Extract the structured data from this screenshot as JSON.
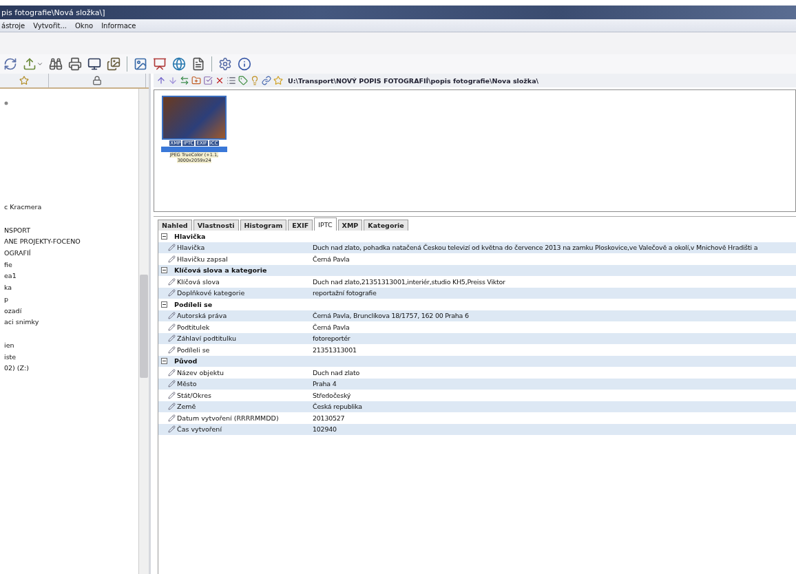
{
  "window": {
    "title": "pis fotografie\\Nová složka\\]"
  },
  "menu": [
    "ástroje",
    "Vytvořit...",
    "Okno",
    "Informace"
  ],
  "tree": {
    "groups": [
      [
        "c Kracmera"
      ],
      [
        "NSPORT",
        "ANE PROJEKTY-FOCENO",
        "OGRAFIÍ",
        "fie",
        "ea1",
        "ka",
        "p",
        "ozadí",
        "aci snimky"
      ],
      [
        "ien",
        "iste",
        "02) (Z:)"
      ]
    ]
  },
  "browser": {
    "path": "U:\\Transport\\NOVÝ POPIS FOTOGRAFIÍ\\popis fotografie\\Nova složka\\",
    "thumbnail": {
      "selected": true,
      "badges": [
        "XMP",
        "IPTC",
        "EXIF",
        "ICC"
      ],
      "caption_lines": [
        "JPEG TrueColor (+1.1,",
        "3000x2059x24"
      ]
    }
  },
  "tabs": [
    {
      "label": "Nahled",
      "selected": false
    },
    {
      "label": "Vlastnosti",
      "selected": false
    },
    {
      "label": "Histogram",
      "selected": false
    },
    {
      "label": "EXIF",
      "selected": false
    },
    {
      "label": "IPTC",
      "selected": true
    },
    {
      "label": "XMP",
      "selected": false
    },
    {
      "label": "Kategorie",
      "selected": false
    }
  ],
  "properties": [
    {
      "title": "Hlavička",
      "expanded": true,
      "rows": [
        {
          "name": "Hlavička",
          "value": "Duch nad zlato, pohadka natačená Českou televizí od května do července 2013 na zamku Ploskovice,ve Valečově a okolí,v Mnichově Hradišti a"
        },
        {
          "name": "Hlavičku zapsal",
          "value": "Černá Pavla"
        }
      ]
    },
    {
      "title": "Klíčová slova a kategorie",
      "expanded": true,
      "rows": [
        {
          "name": "Klíčová slova",
          "value": "Duch nad zlato,21351313001,interiér,studio KH5,Preiss Viktor"
        },
        {
          "name": "Doplňkové kategorie",
          "value": "reportažní fotografie"
        }
      ]
    },
    {
      "title": "Podíleli se",
      "expanded": true,
      "rows": [
        {
          "name": "Autorská práva",
          "value": "Černá Pavla, Brunclíkova 18/1757, 162 00 Praha 6"
        },
        {
          "name": "Podtitulek",
          "value": "Černá Pavla"
        },
        {
          "name": "Záhlaví podtitulku",
          "value": "fotoreportér"
        },
        {
          "name": "Podíleli se",
          "value": "21351313001"
        }
      ]
    },
    {
      "title": "Původ",
      "expanded": true,
      "rows": [
        {
          "name": "Název objektu",
          "value": "Duch nad zlato"
        },
        {
          "name": "Město",
          "value": "Praha 4"
        },
        {
          "name": "Stát/Okres",
          "value": "Středočeský"
        },
        {
          "name": "Země",
          "value": "Česká republika"
        },
        {
          "name": "Datum vytvoření (RRRRMMDD)",
          "value": "20130527"
        },
        {
          "name": "Čas vytvoření",
          "value": "102940"
        }
      ]
    }
  ]
}
